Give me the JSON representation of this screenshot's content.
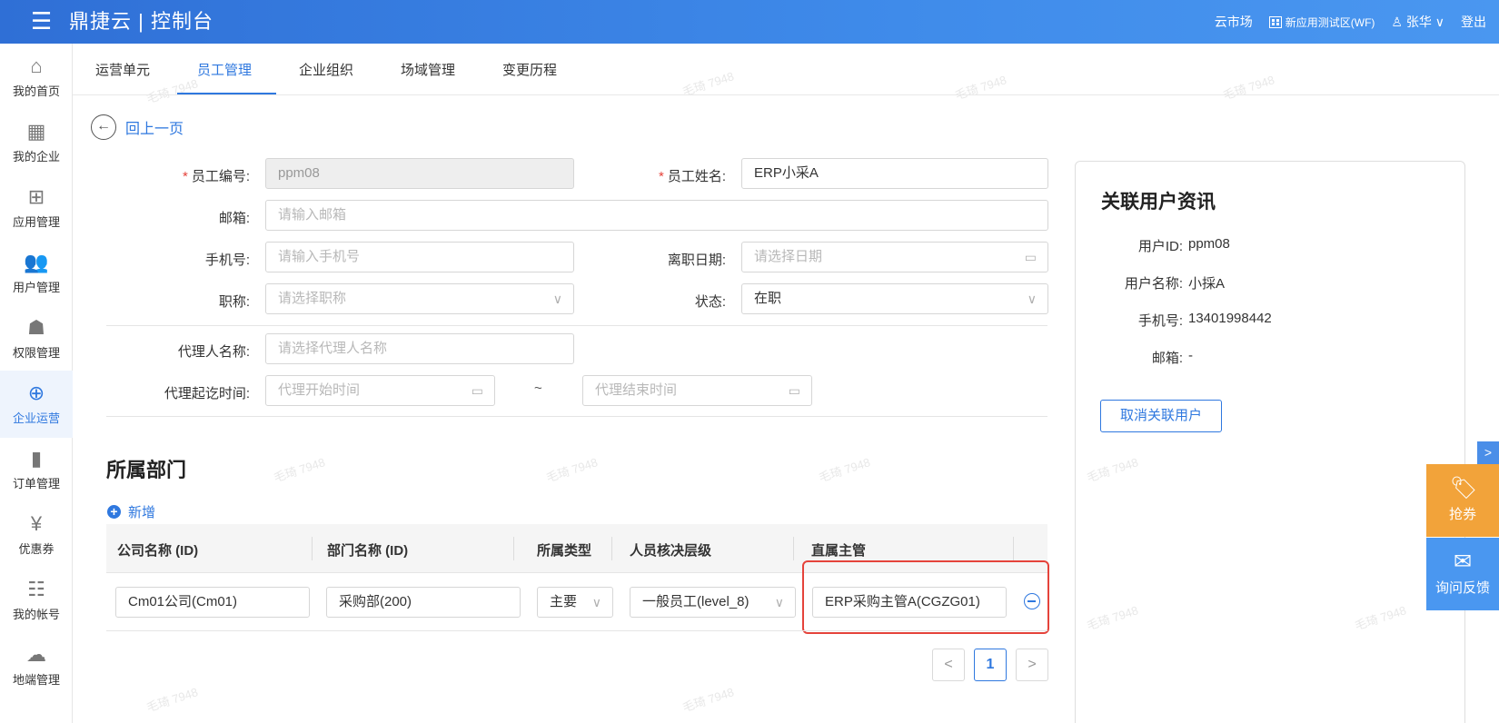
{
  "header": {
    "menu_icon": "hamburger-icon",
    "brand": "鼎捷云 | 控制台",
    "market": "云市场",
    "region": "新应用测试区(WF)",
    "user": "张华 ∨",
    "logout": "登出"
  },
  "sidebar": {
    "items": [
      {
        "label": "我的首页",
        "icon": "home-icon"
      },
      {
        "label": "我的企业",
        "icon": "building-icon"
      },
      {
        "label": "应用管理",
        "icon": "apps-grid-icon"
      },
      {
        "label": "用户管理",
        "icon": "users-icon"
      },
      {
        "label": "权限管理",
        "icon": "user-key-icon"
      },
      {
        "label": "企业运营",
        "icon": "globe-icon"
      },
      {
        "label": "订单管理",
        "icon": "bookmark-icon"
      },
      {
        "label": "优惠券",
        "icon": "coupon-icon"
      },
      {
        "label": "我的帐号",
        "icon": "sliders-icon"
      },
      {
        "label": "地端管理",
        "icon": "cloud-icon"
      }
    ]
  },
  "tabs": [
    "运营单元",
    "员工管理",
    "企业组织",
    "场域管理",
    "变更历程"
  ],
  "back_label": "回上一页",
  "form": {
    "employee_id_label": "员工编号:",
    "employee_id_value": "ppm08",
    "employee_name_label": "员工姓名:",
    "employee_name_value": "ERP小采A",
    "email_label": "邮箱:",
    "email_placeholder": "请输入邮箱",
    "phone_label": "手机号:",
    "phone_placeholder": "请输入手机号",
    "leave_date_label": "离职日期:",
    "leave_date_placeholder": "请选择日期",
    "title_label": "职称:",
    "title_placeholder": "请选择职称",
    "status_label": "状态:",
    "status_value": "在职",
    "agent_label": "代理人名称:",
    "agent_placeholder": "请选择代理人名称",
    "agent_period_label": "代理起讫时间:",
    "agent_start_placeholder": "代理开始时间",
    "agent_end_placeholder": "代理结束时间",
    "range_separator": "~"
  },
  "department": {
    "title": "所属部门",
    "add_label": "新增",
    "columns": [
      "公司名称 (ID)",
      "部门名称 (ID)",
      "所属类型",
      "人员核决层级",
      "直属主管"
    ],
    "rows": [
      {
        "company": "Cm01公司(Cm01)",
        "dept": "采购部(200)",
        "type": "主要",
        "level": "一般员工(level_8)",
        "manager": "ERP采购主管A(CGZG01)"
      }
    ],
    "pagination": {
      "prev": "<",
      "current": "1",
      "next": ">"
    }
  },
  "user_info": {
    "title": "关联用户资讯",
    "user_id_label": "用户ID:",
    "user_id": "ppm08",
    "user_name_label": "用户名称:",
    "user_name": "小採A",
    "phone_label": "手机号:",
    "phone": "13401998442",
    "email_label": "邮箱:",
    "email": "-",
    "unlink_button": "取消关联用户"
  },
  "floating": {
    "expand": ">",
    "coupon": "抢券",
    "feedback": "询问反馈"
  },
  "watermark": "毛琦 7948",
  "colors": {
    "primary": "#2f78df",
    "header": "#3f8bea",
    "required": "#e5433b",
    "coupon": "#f2a33a"
  }
}
